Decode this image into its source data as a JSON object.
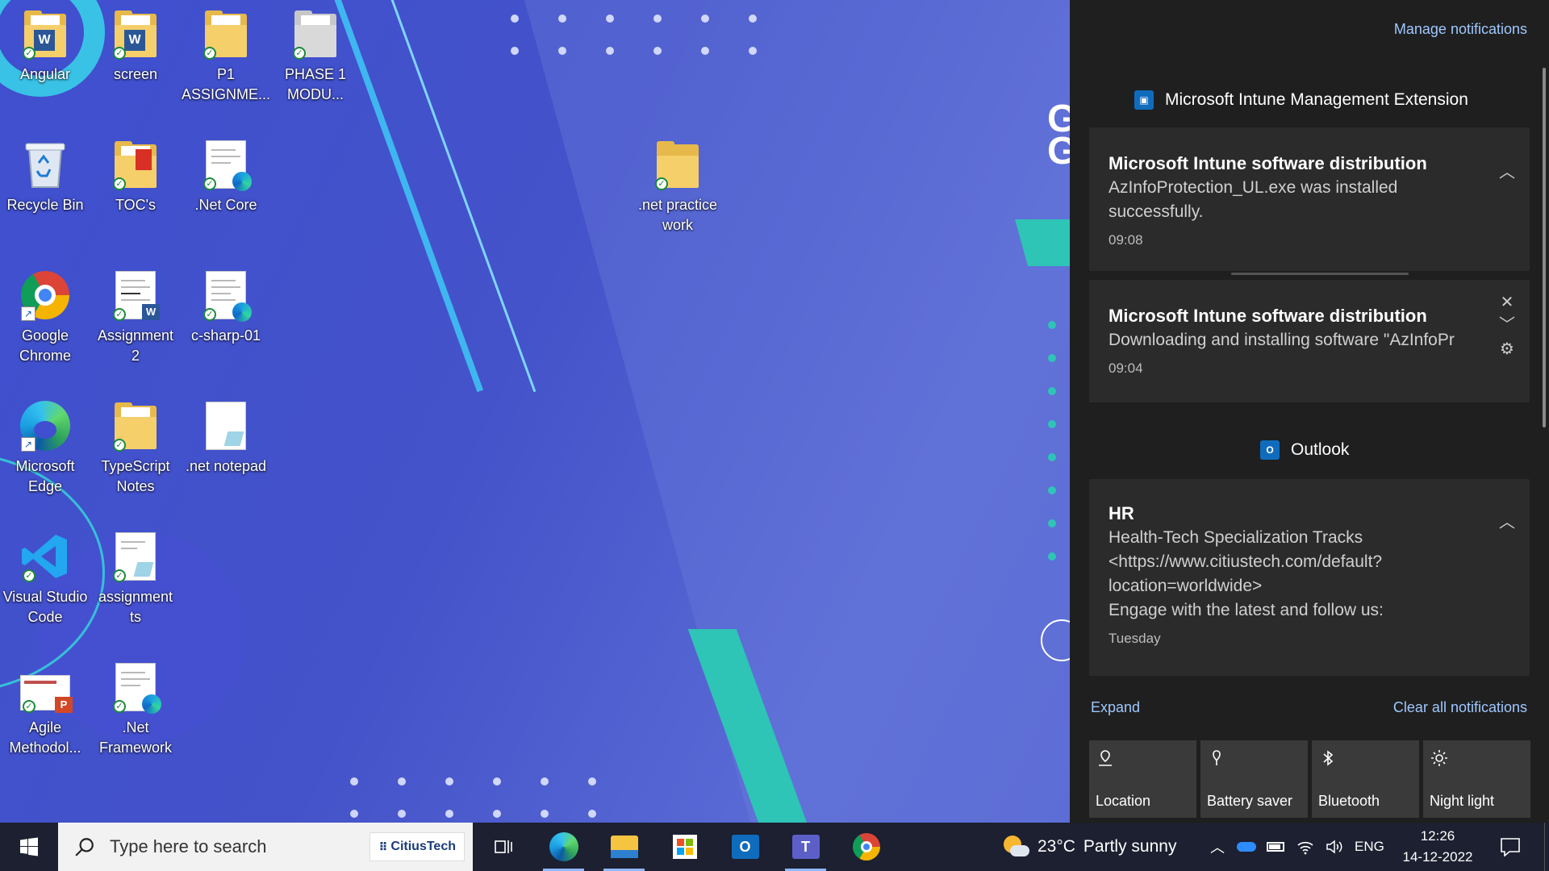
{
  "desktop": {
    "icons": [
      {
        "label": "Angular",
        "type": "folder-word"
      },
      {
        "label": "screen",
        "type": "folder-word"
      },
      {
        "label": "P1\nASSIGNME...",
        "type": "folder"
      },
      {
        "label": "PHASE 1\nMODU...",
        "type": "folder-gray"
      },
      {
        "label": "Recycle Bin",
        "type": "recycle"
      },
      {
        "label": "TOC's",
        "type": "folder-pdf"
      },
      {
        "label": ".Net Core",
        "type": "doc-edge"
      },
      {
        "label": "Google\nChrome",
        "type": "chrome"
      },
      {
        "label": "Assignment\n2",
        "type": "doc-word"
      },
      {
        "label": "c-sharp-01",
        "type": "doc-edge"
      },
      {
        "label": "Microsoft\nEdge",
        "type": "edge"
      },
      {
        "label": "TypeScript\nNotes",
        "type": "folder"
      },
      {
        "label": ".net notepad",
        "type": "doc-notepad"
      },
      {
        "label": "Visual Studio\nCode",
        "type": "vscode"
      },
      {
        "label": "assignment\nts",
        "type": "doc-notepad"
      },
      {
        "label": "Agile\nMethodol...",
        "type": "ppt"
      },
      {
        "label": ".Net\nFramework",
        "type": "doc-edge"
      },
      {
        "label": ".net practice\nwork",
        "type": "folder"
      }
    ]
  },
  "action_center": {
    "manage_label": "Manage notifications",
    "groups": [
      {
        "app": "Microsoft Intune Management Extension",
        "notifications": [
          {
            "title": "Microsoft Intune software distribution",
            "body": "AzInfoProtection_UL.exe was installed\nsuccessfully.",
            "time": "09:08"
          },
          {
            "title": "Microsoft Intune software distribution",
            "body": "Downloading and installing software \"AzInfoPr",
            "time": "09:04"
          }
        ]
      },
      {
        "app": "Outlook",
        "notifications": [
          {
            "title": "HR",
            "body": "Health-Tech Specialization Tracks\n<https://www.citiustech.com/default?\nlocation=worldwide>\nEngage with the latest and follow us:",
            "time": "Tuesday"
          }
        ]
      }
    ],
    "expand_label": "Expand",
    "clear_label": "Clear all notifications",
    "quick_actions": [
      "Location",
      "Battery saver",
      "Bluetooth",
      "Night light"
    ]
  },
  "taskbar": {
    "search_placeholder": "Type here to search",
    "search_brand": "CitiusTech",
    "apps": [
      "task-view",
      "edge",
      "file-explorer",
      "microsoft-store",
      "outlook",
      "teams",
      "chrome"
    ],
    "weather": {
      "temp": "23°C",
      "desc": "Partly sunny"
    },
    "lang": "ENG",
    "time": "12:26",
    "date": "14-12-2022"
  },
  "colors": {
    "accent": "#9fc8ff",
    "panel": "#1f1f1f",
    "card": "#2b2b2b",
    "teal": "#2ec4b6"
  }
}
